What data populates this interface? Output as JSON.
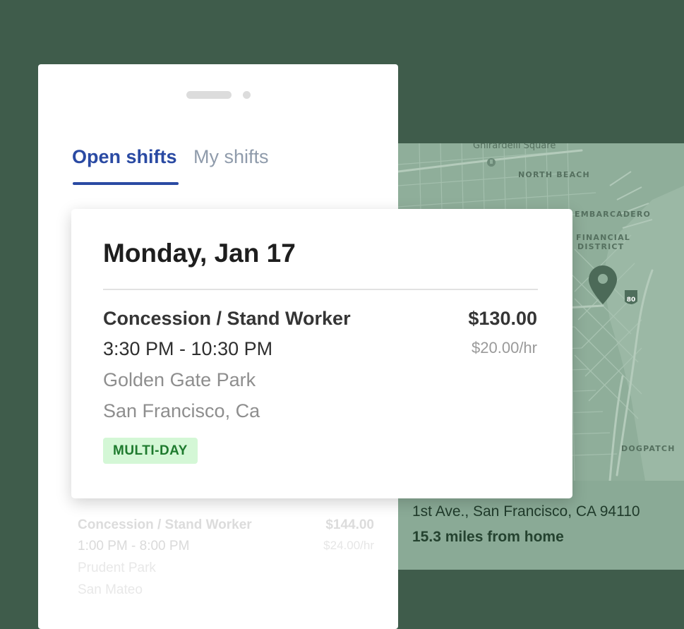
{
  "map": {
    "labels": {
      "ghirardelli": "Ghirardelli Square",
      "north_beach": "NORTH BEACH",
      "embarcadero": "EMBARCADERO",
      "financial_1": "FINANCIAL",
      "financial_2": "DISTRICT",
      "dogpatch": "DOGPATCH",
      "highway": "80"
    },
    "address": "1st Ave., San Francisco, CA 94110",
    "distance": "15.3 miles from home",
    "pin_icon": "map-pin-icon"
  },
  "tabs": [
    {
      "label": "Open shifts",
      "active": true
    },
    {
      "label": "My shifts",
      "active": false
    }
  ],
  "featured_shift": {
    "date": "Monday, Jan 17",
    "title": "Concession / Stand Worker",
    "total_pay": "$130.00",
    "time": "3:30 PM - 10:30 PM",
    "rate": "$20.00/hr",
    "location": "Golden Gate Park",
    "city": "San Francisco, Ca",
    "badge": "MULTI-DAY"
  },
  "next_shift": {
    "title": "Concession / Stand Worker",
    "total_pay": "$144.00",
    "time": "1:00 PM - 8:00 PM",
    "rate": "$24.00/hr",
    "location": "Prudent Park",
    "city": "San Mateo"
  },
  "colors": {
    "background": "#3f5c4b",
    "accent": "#2a4aa3",
    "badge_bg": "#d4f7d6",
    "badge_text": "#1e7a2e",
    "map": "#8fae9a"
  }
}
